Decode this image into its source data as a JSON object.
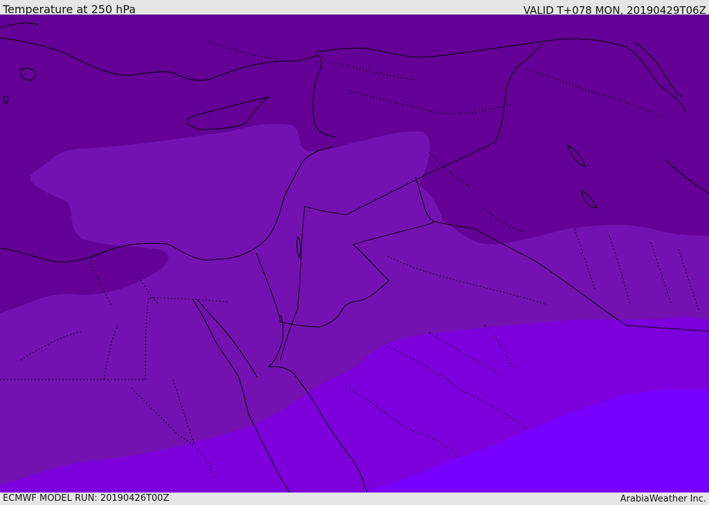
{
  "header": {
    "title": "Temperature at 250 hPa",
    "valid": "VALID T+078 MON, 20190429T06Z"
  },
  "footer": {
    "model_run": "ECMWF MODEL RUN: 20190426T00Z",
    "credit": "ArabiaWeather Inc."
  },
  "colors": {
    "zone_darkest": "#640096",
    "zone_mid": "#7312b0",
    "zone_light": "#7d00dc",
    "zone_lightest": "#7800ff",
    "bar_background": "#e6e6e6",
    "line": "#000000"
  }
}
